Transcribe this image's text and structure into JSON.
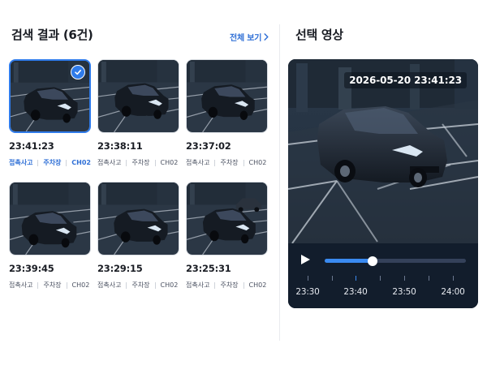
{
  "left": {
    "title": "검색 결과 (6건)",
    "view_all": "전체 보기"
  },
  "results": [
    {
      "time": "23:41:23",
      "tags": [
        "접촉사고",
        "주차장",
        "CH02"
      ],
      "selected": true
    },
    {
      "time": "23:38:11",
      "tags": [
        "접촉사고",
        "주차장",
        "CH02"
      ],
      "selected": false
    },
    {
      "time": "23:37:02",
      "tags": [
        "접촉사고",
        "주차장",
        "CH02"
      ],
      "selected": false
    },
    {
      "time": "23:39:45",
      "tags": [
        "접촉사고",
        "주차장",
        "CH02"
      ],
      "selected": false
    },
    {
      "time": "23:29:15",
      "tags": [
        "접촉사고",
        "주차장",
        "CH02"
      ],
      "selected": false
    },
    {
      "time": "23:25:31",
      "tags": [
        "접촉사고",
        "주차장",
        "CH02"
      ],
      "selected": false
    }
  ],
  "right": {
    "title": "선택 영상",
    "timestamp": "2026-05-20 23:41:23"
  },
  "player": {
    "progress": 0.34,
    "timeline_labels": [
      "23:30",
      "23:40",
      "23:50",
      "24:00"
    ]
  },
  "colors": {
    "accent": "#2f7bea",
    "link": "#2f6fd6",
    "player_bg": "#121d2c"
  },
  "icons": {
    "check": "check-icon",
    "chevron": "chevron-right-icon",
    "play": "play-icon"
  }
}
